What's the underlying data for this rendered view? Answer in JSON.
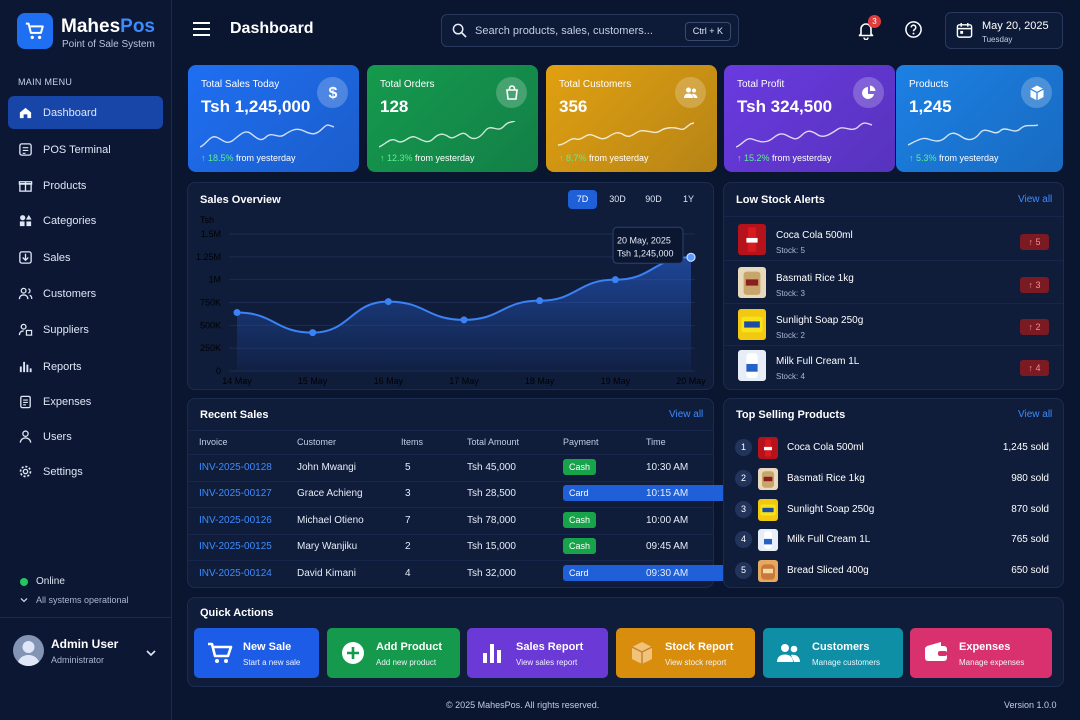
{
  "brand": {
    "name_a": "Mahes",
    "name_b": "Pos",
    "tagline": "Point of Sale System"
  },
  "sidebar": {
    "menu_heading": "MAIN MENU",
    "items": [
      {
        "label": "Dashboard",
        "icon": "home-icon"
      },
      {
        "label": "POS Terminal",
        "icon": "terminal-icon"
      },
      {
        "label": "Products",
        "icon": "gift-icon"
      },
      {
        "label": "Categories",
        "icon": "shapes-icon"
      },
      {
        "label": "Sales",
        "icon": "download-icon"
      },
      {
        "label": "Customers",
        "icon": "users-icon"
      },
      {
        "label": "Suppliers",
        "icon": "supplier-icon"
      },
      {
        "label": "Reports",
        "icon": "bar-chart-icon"
      },
      {
        "label": "Expenses",
        "icon": "clipboard-icon"
      },
      {
        "label": "Users",
        "icon": "user-group-icon"
      },
      {
        "label": "Settings",
        "icon": "gear-icon"
      }
    ],
    "status": {
      "label": "Online",
      "sub": "All systems operational",
      "color": "#22c55e"
    },
    "user": {
      "name": "Admin User",
      "role": "Administrator"
    }
  },
  "header": {
    "title": "Dashboard",
    "search_placeholder": "Search products, sales, customers...",
    "shortcut": "Ctrl + K",
    "notifications": "3",
    "date": "May 20, 2025",
    "weekday": "Tuesday"
  },
  "stats": [
    {
      "label": "Total Sales Today",
      "value": "Tsh 1,245,000",
      "change": "↑ 18.5%",
      "suffix": " from yesterday",
      "icon": "dollar-icon",
      "color": "#1f6ff2"
    },
    {
      "label": "Total Orders",
      "value": "128",
      "change": "↑ 12.3%",
      "suffix": " from yesterday",
      "icon": "shopping-bag-icon",
      "color": "#159a4d"
    },
    {
      "label": "Total Customers",
      "value": "356",
      "change": "↑ 8.7%",
      "suffix": " from yesterday",
      "icon": "users-icon",
      "color": "#e1a010"
    },
    {
      "label": "Total Profit",
      "value": "Tsh 324,500",
      "change": "↑ 15.2%",
      "suffix": " from yesterday",
      "icon": "pie-chart-icon",
      "color": "#6a3ae0"
    },
    {
      "label": "Products",
      "value": "1,245",
      "change": "↑ 5.3%",
      "suffix": " from yesterday",
      "icon": "box-icon",
      "color": "#1c80e4"
    }
  ],
  "sales_overview": {
    "title": "Sales Overview",
    "ranges": [
      "7D",
      "30D",
      "90D",
      "1Y"
    ],
    "active_range": "7D",
    "tooltip_date": "20 May, 2025",
    "tooltip_value": "Tsh 1,245,000"
  },
  "chart_data": {
    "type": "area",
    "title": "Sales Overview",
    "ylabel": "Tsh",
    "x": [
      "14 May",
      "15 May",
      "16 May",
      "17 May",
      "18 May",
      "19 May",
      "20 May"
    ],
    "values": [
      640000,
      420000,
      760000,
      560000,
      770000,
      1000000,
      1245000
    ],
    "ylim": [
      0,
      1500000
    ],
    "yticks": [
      "0",
      "250K",
      "500K",
      "750K",
      "1M",
      "1.25M",
      "1.5M"
    ],
    "grid": true,
    "color": "#3b82f6"
  },
  "low_stock": {
    "title": "Low Stock Alerts",
    "view_all": "View all",
    "items": [
      {
        "name": "Coca Cola 500ml",
        "stock": "Stock: 5",
        "count": "5"
      },
      {
        "name": "Basmati Rice 1kg",
        "stock": "Stock: 3",
        "count": "3"
      },
      {
        "name": "Sunlight Soap 250g",
        "stock": "Stock: 2",
        "count": "2"
      },
      {
        "name": "Milk Full Cream 1L",
        "stock": "Stock: 4",
        "count": "4"
      }
    ]
  },
  "recent_sales": {
    "title": "Recent Sales",
    "view_all": "View all",
    "columns": [
      "Invoice",
      "Customer",
      "Items",
      "Total Amount",
      "Payment",
      "Time"
    ],
    "rows": [
      {
        "invoice": "INV-2025-00128",
        "customer": "John Mwangi",
        "items": "5",
        "total": "Tsh 45,000",
        "payment": "Cash",
        "time": "10:30 AM"
      },
      {
        "invoice": "INV-2025-00127",
        "customer": "Grace Achieng",
        "items": "3",
        "total": "Tsh 28,500",
        "payment": "Card",
        "time": "10:15 AM"
      },
      {
        "invoice": "INV-2025-00126",
        "customer": "Michael Otieno",
        "items": "7",
        "total": "Tsh 78,000",
        "payment": "Cash",
        "time": "10:00 AM"
      },
      {
        "invoice": "INV-2025-00125",
        "customer": "Mary Wanjiku",
        "items": "2",
        "total": "Tsh 15,000",
        "payment": "Cash",
        "time": "09:45 AM"
      },
      {
        "invoice": "INV-2025-00124",
        "customer": "David Kimani",
        "items": "4",
        "total": "Tsh 32,000",
        "payment": "Card",
        "time": "09:30 AM"
      }
    ]
  },
  "top_selling": {
    "title": "Top Selling Products",
    "view_all": "View all",
    "items": [
      {
        "rank": "1",
        "name": "Coca Cola 500ml",
        "sold": "1,245 sold"
      },
      {
        "rank": "2",
        "name": "Basmati Rice 1kg",
        "sold": "980 sold"
      },
      {
        "rank": "3",
        "name": "Sunlight Soap 250g",
        "sold": "870 sold"
      },
      {
        "rank": "4",
        "name": "Milk Full Cream 1L",
        "sold": "765 sold"
      },
      {
        "rank": "5",
        "name": "Bread Sliced 400g",
        "sold": "650 sold"
      }
    ]
  },
  "quick_actions": {
    "title": "Quick Actions",
    "items": [
      {
        "title": "New Sale",
        "sub": "Start a new sale",
        "icon": "cart-icon",
        "color": "#1d5ce6"
      },
      {
        "title": "Add Product",
        "sub": "Add new product",
        "icon": "plus-circle-icon",
        "color": "#159a4d"
      },
      {
        "title": "Sales Report",
        "sub": "View sales report",
        "icon": "bar-chart-icon",
        "color": "#6b3ad6"
      },
      {
        "title": "Stock Report",
        "sub": "View stock report",
        "icon": "box-icon",
        "color": "#d98d0c"
      },
      {
        "title": "Customers",
        "sub": "Manage customers",
        "icon": "users-icon",
        "color": "#0f8fa6"
      },
      {
        "title": "Expenses",
        "sub": "Manage expenses",
        "icon": "wallet-icon",
        "color": "#d8316e"
      }
    ]
  },
  "footer": {
    "copyright": "© 2025 MahesPos. All rights reserved.",
    "version": "Version 1.0.0"
  }
}
